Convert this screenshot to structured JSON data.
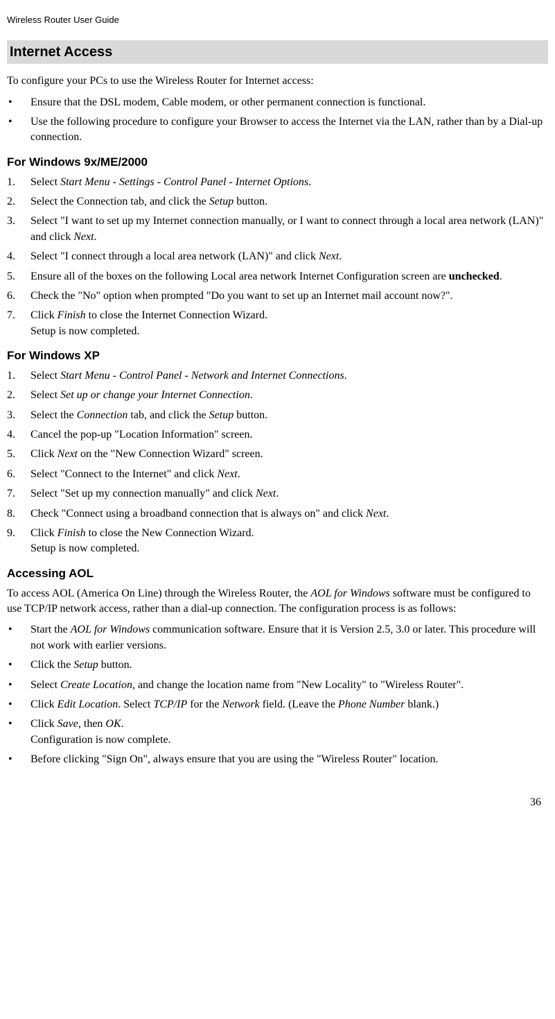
{
  "header": {
    "doc_title": "Wireless Router User Guide"
  },
  "section": {
    "title": "Internet Access",
    "intro": "To configure your PCs to use the Wireless Router for Internet access:",
    "intro_bullets": {
      "b1": "Ensure that the DSL modem, Cable modem, or other permanent connection is functional.",
      "b2": "Use the following procedure to configure your Browser to access the Internet via the LAN, rather than by a Dial-up connection."
    }
  },
  "win9x": {
    "heading": "For Windows 9x/ME/2000",
    "s1_a": "Select ",
    "s1_i": "Start Menu - Settings - Control Panel - Internet Options",
    "s1_b": ".",
    "s2_a": "Select the Connection tab, and click the ",
    "s2_i": "Setup",
    "s2_b": " button.",
    "s3_a": "Select \"I want to set up my Internet connection manually, or I want to connect through a local area network (LAN)\" and click ",
    "s3_i": "Next",
    "s3_b": ".",
    "s4_a": "Select \"I connect through a local area network (LAN)\" and click ",
    "s4_i": "Next",
    "s4_b": ".",
    "s5_a": "Ensure all of the boxes on the following Local area network Internet Configuration screen are ",
    "s5_bold": "unchecked",
    "s5_b": ".",
    "s6": "Check the \"No\" option when prompted \"Do you want to set up an Internet mail account now?\".",
    "s7_a": "Click ",
    "s7_i": "Finish",
    "s7_b": " to close the Internet Connection Wizard.",
    "s7_c": "Setup is now completed."
  },
  "winxp": {
    "heading": "For Windows XP",
    "s1_a": "Select ",
    "s1_i": "Start Menu - Control Panel - Network and Internet Connections",
    "s1_b": ".",
    "s2_a": "Select ",
    "s2_i": "Set up or change your Internet Connection",
    "s2_b": ".",
    "s3_a": "Select the ",
    "s3_i1": "Connection",
    "s3_m": " tab, and click the ",
    "s3_i2": "Setup",
    "s3_b": " button.",
    "s4": "Cancel the pop-up \"Location Information\" screen.",
    "s5_a": "Click ",
    "s5_i": "Next",
    "s5_b": " on the \"New Connection Wizard\" screen.",
    "s6_a": "Select \"Connect to the Internet\" and click ",
    "s6_i": "Next",
    "s6_b": ".",
    "s7_a": "Select \"Set up my connection manually\" and click ",
    "s7_i": "Next",
    "s7_b": ".",
    "s8_a": "Check \"Connect using a broadband connection that is always on\" and click ",
    "s8_i": "Next",
    "s8_b": ".",
    "s9_a": "Click ",
    "s9_i": "Finish",
    "s9_b": " to close the New Connection Wizard.",
    "s9_c": "Setup is now completed."
  },
  "aol": {
    "heading": "Accessing AOL",
    "intro_a": "To access AOL (America On Line) through the Wireless Router, the ",
    "intro_i": "AOL for Windows",
    "intro_b": " software must be configured to use TCP/IP network access, rather than a dial-up connection. The configuration process is as follows:",
    "b1_a": "Start the ",
    "b1_i": "AOL for Windows",
    "b1_b": " communication software. Ensure that it is Version 2.5, 3.0 or later. This procedure will not work with earlier versions.",
    "b2_a": "Click the ",
    "b2_i": "Setup",
    "b2_b": " button.",
    "b3_a": "Select ",
    "b3_i": "Create Location",
    "b3_b": ", and change the location name from \"New Locality\" to \"Wireless Router\".",
    "b4_a": "Click ",
    "b4_i1": "Edit Location",
    "b4_m1": ". Select ",
    "b4_i2": "TCP/IP",
    "b4_m2": " for the ",
    "b4_i3": "Network",
    "b4_m3": " field. (Leave the ",
    "b4_i4": "Phone Number",
    "b4_b": " blank.)",
    "b5_a": "Click ",
    "b5_i1": "Save",
    "b5_m": ", then ",
    "b5_i2": "OK",
    "b5_b": ".",
    "b5_c": "Configuration is now complete.",
    "b6": "Before clicking \"Sign On\", always ensure that you are using the \"Wireless Router\" location."
  },
  "page_number": "36",
  "bullet_char": "•"
}
